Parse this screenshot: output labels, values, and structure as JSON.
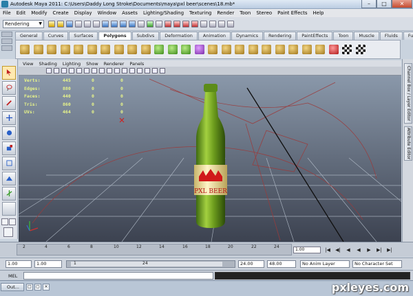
{
  "window": {
    "title": "Autodesk Maya 2011: C:\\Users\\Daddy Long Stroke\\Documents\\maya\\pxl beer\\scenes\\18.mb*",
    "minimize": "–",
    "maximize": "□",
    "close": "✕"
  },
  "menu": [
    "File",
    "Edit",
    "Modify",
    "Create",
    "Display",
    "Window",
    "Assets",
    "Lighting/Shading",
    "Texturing",
    "Render",
    "Toon",
    "Stereo",
    "Paint Effects",
    "Help"
  ],
  "status_line": {
    "mode": "Rendering"
  },
  "shelf": {
    "tabs": [
      "General",
      "Curves",
      "Surfaces",
      "Polygons",
      "Subdivs",
      "Deformation",
      "Animation",
      "Dynamics",
      "Rendering",
      "PaintEffects",
      "Toon",
      "Muscle",
      "Fluids",
      "Fur"
    ],
    "active_tab": "Polygons"
  },
  "panel_menu": [
    "View",
    "Shading",
    "Lighting",
    "Show",
    "Renderer",
    "Panels"
  ],
  "hud": {
    "rows": [
      {
        "label": "Verts:",
        "a": "445",
        "b": "0",
        "c": "0"
      },
      {
        "label": "Edges:",
        "a": "880",
        "b": "0",
        "c": "0"
      },
      {
        "label": "Faces:",
        "a": "440",
        "b": "0",
        "c": "0"
      },
      {
        "label": "Tris:",
        "a": "860",
        "b": "0",
        "c": "0"
      },
      {
        "label": "UVs:",
        "a": "464",
        "b": "0",
        "c": "0"
      }
    ]
  },
  "bottle": {
    "label_text": "PXL BEER"
  },
  "right_panels": [
    "Channel Box / Layer Editor",
    "Attribute Editor"
  ],
  "time_slider": {
    "ticks": [
      "2",
      "4",
      "6",
      "8",
      "10",
      "12",
      "14",
      "16",
      "18",
      "20",
      "22",
      "24"
    ],
    "current_frame": "1.00",
    "play_controls": [
      "|◀",
      "◀|",
      "◀",
      "◀",
      "▶",
      "▶|",
      "▶|"
    ]
  },
  "range_slider": {
    "start_time": "1.00",
    "range_start": "1.00",
    "inner_start": "1",
    "inner_end": "24",
    "range_end": "24.00",
    "end_time": "48.00",
    "anim_layer": "No Anim Layer",
    "character_set": "No Character Set"
  },
  "command_line": {
    "label": "MEL"
  },
  "taskbar": {
    "button": "Out..."
  },
  "watermark": "pxleyes.com"
}
